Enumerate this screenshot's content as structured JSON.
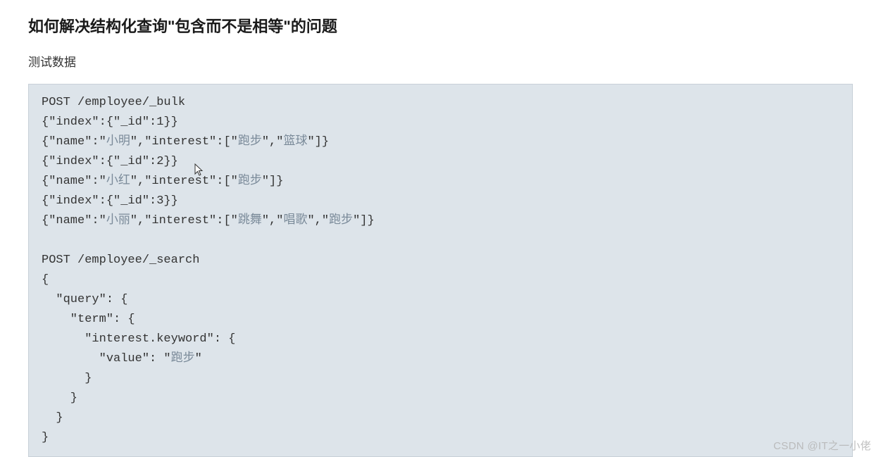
{
  "heading": "如何解决结构化查询\"包含而不是相等\"的问题",
  "subhead": "测试数据",
  "code": {
    "bulk": {
      "request_line": "POST /employee/_bulk",
      "line1_pre": "{\"index\":{\"_id\":1}}",
      "line2_pre": "{\"name\":\"",
      "line2_s1": "小明",
      "line2_mid1": "\",\"interest\":[\"",
      "line2_s2": "跑步",
      "line2_mid2": "\",\"",
      "line2_s3": "篮球",
      "line2_post": "\"]}",
      "line3_pre": "{\"index\":{\"_id\":2}}",
      "line4_pre": "{\"name\":\"",
      "line4_s1": "小红",
      "line4_mid1": "\",\"interest\":[\"",
      "line4_s2": "跑步",
      "line4_post": "\"]}",
      "line5_pre": "{\"index\":{\"_id\":3}}",
      "line6_pre": "{\"name\":\"",
      "line6_s1": "小丽",
      "line6_mid1": "\",\"interest\":[\"",
      "line6_s2": "跳舞",
      "line6_mid2": "\",\"",
      "line6_s3": "唱歌",
      "line6_mid3": "\",\"",
      "line6_s4": "跑步",
      "line6_post": "\"]}"
    },
    "search": {
      "request_line": "POST /employee/_search",
      "l1": "{",
      "l2": "  \"query\": {",
      "l3": "    \"term\": {",
      "l4": "      \"interest.keyword\": {",
      "l5a": "        \"value\": \"",
      "l5s": "跑步",
      "l5b": "\"",
      "l6": "      }",
      "l7": "    }",
      "l8": "  }",
      "l9": "}"
    }
  },
  "watermark": "CSDN @IT之一小佬"
}
